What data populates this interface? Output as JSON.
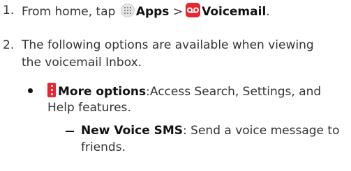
{
  "steps": [
    {
      "number": "1.",
      "pre": "From home, tap",
      "apps_label": "Apps",
      "separator": ">",
      "voicemail_label": "Voicemail",
      "end": "."
    },
    {
      "number": "2.",
      "text_line1": "The following options are available when viewing",
      "text_line2": "the voicemail Inbox."
    }
  ],
  "more_options": {
    "label": "More options",
    "desc_line1": ":Access Search, Settings, and",
    "desc_line2": "Help features."
  },
  "new_voice_sms": {
    "label": "New Voice SMS",
    "desc_line1": ": Send a voice message to",
    "desc_line2": "friends."
  },
  "icons": {
    "apps": "apps-grid-icon",
    "voicemail": "voicemail-icon",
    "more": "more-options-icon"
  },
  "colors": {
    "accent": "#e8262f",
    "text": "#333333",
    "bold_text": "#111111"
  }
}
